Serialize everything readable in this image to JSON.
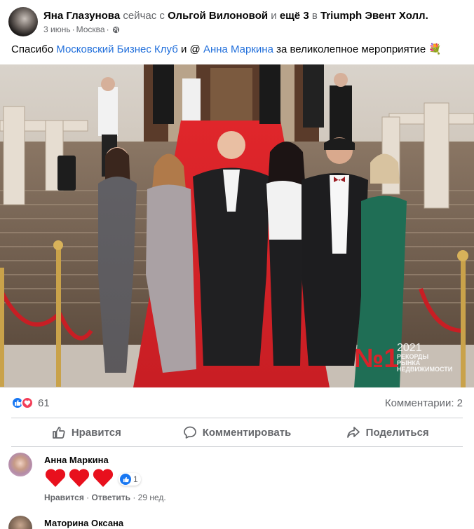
{
  "post": {
    "author": "Яна Глазунова",
    "with_text": "сейчас с",
    "tagged_person": "Ольгой Вилоновой",
    "and_text": "и",
    "others": "ещё 3",
    "in_text": "в",
    "place": "Triumph Эвент Холл.",
    "date": "3 июнь",
    "location": "Москва",
    "text_part1": "Спасибо",
    "mention1": "Московский Бизнес Клуб",
    "text_part2": "и @",
    "mention2": "Анна Маркина",
    "text_part3": "за великолепное мероприятие 💐"
  },
  "photo": {
    "watermark_number": "№1",
    "watermark_year": "2021",
    "watermark_line1": "РЕКОРДЫ",
    "watermark_line2": "РЫНКА",
    "watermark_line3": "НЕДВИЖИМОСТИ"
  },
  "stats": {
    "reactions_count": "61",
    "comments_label": "Комментарии: 2"
  },
  "actions": {
    "like": "Нравится",
    "comment": "Комментировать",
    "share": "Поделиться"
  },
  "comments": [
    {
      "author": "Анна Маркина",
      "reaction_count": "1",
      "like_label": "Нравится",
      "reply_label": "Ответить",
      "time": "29 нед."
    },
    {
      "author": "Маторина Оксана"
    }
  ],
  "colors": {
    "link": "#216fdb",
    "like_blue": "#1877f2",
    "love_red": "#f33e58",
    "heart": "#e8101d",
    "carpet": "#d8232a",
    "watermark": "#d8232a"
  }
}
